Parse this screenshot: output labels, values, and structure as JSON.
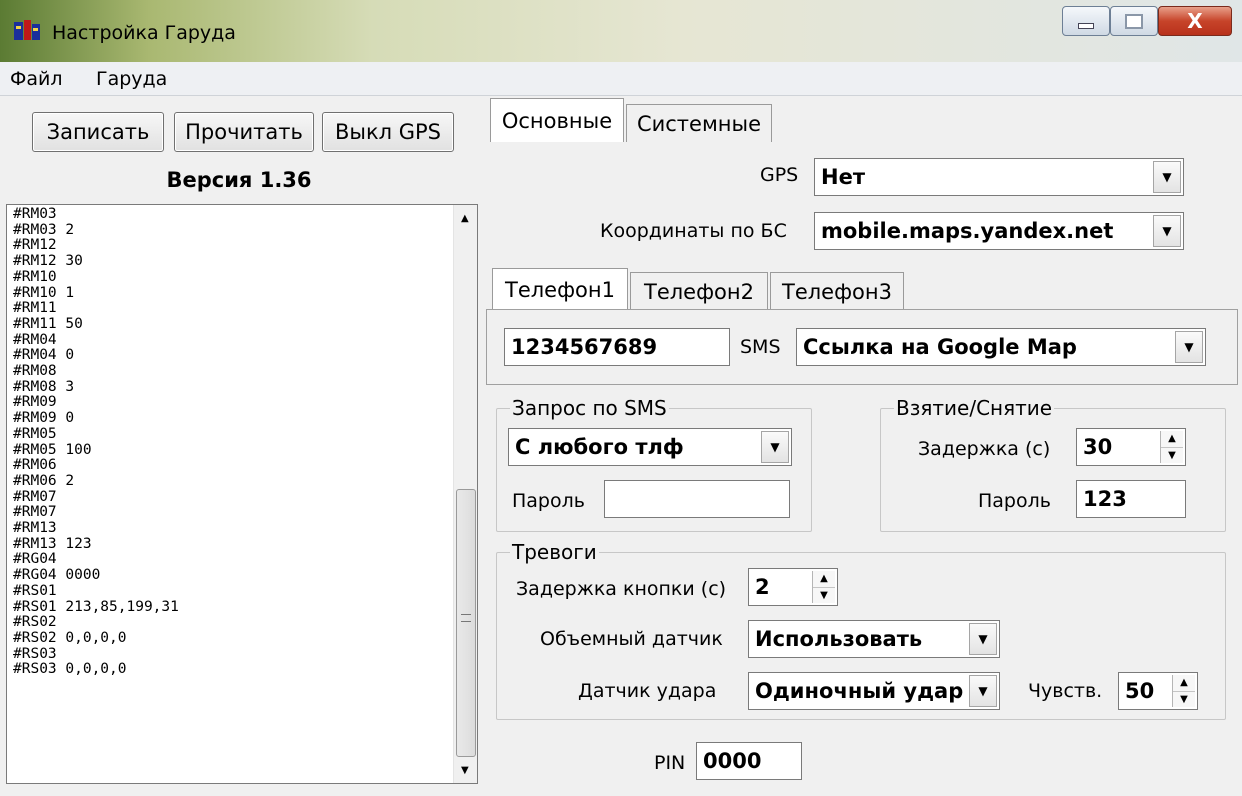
{
  "window": {
    "title": "Настройка Гаруда",
    "close_glyph": "X"
  },
  "menu": {
    "items": [
      "Файл",
      "Гаруда"
    ]
  },
  "toolbar": {
    "write": "Записать",
    "read": "Прочитать",
    "gps_off": "Выкл GPS"
  },
  "version": "Версия 1.36",
  "log": "#RM03\n#RM03 2\n#RM12\n#RM12 30\n#RM10\n#RM10 1\n#RM11\n#RM11 50\n#RM04\n#RM04 0\n#RM08\n#RM08 3\n#RM09\n#RM09 0\n#RM05\n#RM05 100\n#RM06\n#RM06 2\n#RM07\n#RM07\n#RM13\n#RM13 123\n#RG04\n#RG04 0000\n#RS01\n#RS01 213,85,199,31\n#RS02\n#RS02 0,0,0,0\n#RS03\n#RS03 0,0,0,0",
  "tabs": {
    "main": "Основные",
    "system": "Системные"
  },
  "gps": {
    "label": "GPS",
    "value": "Нет"
  },
  "bs": {
    "label": "Координаты по БС",
    "value": "mobile.maps.yandex.net"
  },
  "phone_tabs": [
    "Телефон1",
    "Телефон2",
    "Телефон3"
  ],
  "phone": {
    "number": "1234567689",
    "sms_label": "SMS",
    "sms_value": "Ссылка на Google Map"
  },
  "sms_request": {
    "legend": "Запрос по SMS",
    "mode": "С любого тлф",
    "password_label": "Пароль",
    "password": ""
  },
  "arm": {
    "legend": "Взятие/Снятие",
    "delay_label": "Задержка (с)",
    "delay": "30",
    "password_label": "Пароль",
    "password": "123"
  },
  "alarms": {
    "legend": "Тревоги",
    "button_delay_label": "Задержка кнопки (с)",
    "button_delay": "2",
    "volume_label": "Объемный датчик",
    "volume": "Использовать",
    "shock_label": "Датчик удара",
    "shock": "Одиночный удар",
    "sens_label": "Чувств.",
    "sens": "50"
  },
  "pin": {
    "label": "PIN",
    "value": "0000"
  },
  "icons": {
    "menu_arrows": "▼",
    "spin_up": "▲",
    "spin_down": "▼"
  }
}
